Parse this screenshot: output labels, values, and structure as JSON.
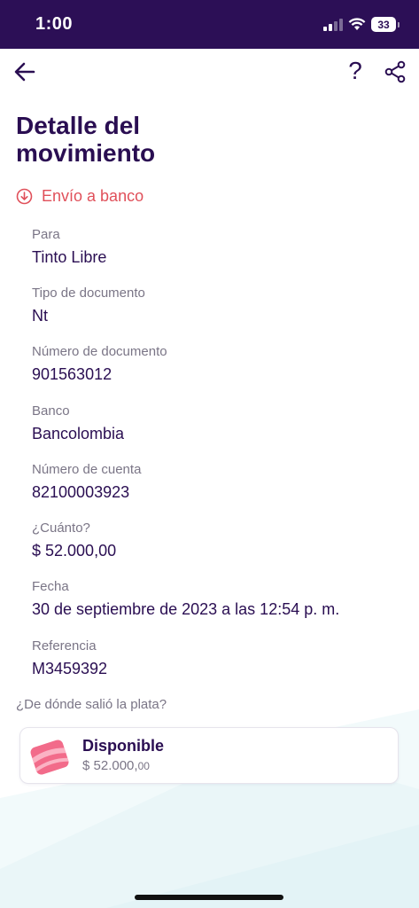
{
  "status_bar": {
    "time": "1:00",
    "battery": "33"
  },
  "header": {
    "help_label": "?"
  },
  "title": "Detalle del movimiento",
  "movement_type": "Envío a banco",
  "fields": [
    {
      "label": "Para",
      "value": "Tinto Libre"
    },
    {
      "label": "Tipo de documento",
      "value": "Nt"
    },
    {
      "label": "Número de documento",
      "value": "901563012"
    },
    {
      "label": "Banco",
      "value": "Bancolombia"
    },
    {
      "label": "Número de cuenta",
      "value": "82100003923"
    },
    {
      "label": "¿Cuánto?",
      "value": "$ 52.000,00"
    },
    {
      "label": "Fecha",
      "value": "30 de septiembre de 2023 a las 12:54 p. m."
    },
    {
      "label": "Referencia",
      "value": "M3459392"
    }
  ],
  "source": {
    "question": "¿De dónde salió la plata?",
    "pocket_name": "Disponible",
    "amount_main": "$ 52.000,",
    "amount_cents": "00"
  },
  "colors": {
    "header_bg": "#2c0f56",
    "primary_text": "#2a0e52",
    "accent_red": "#e0505a",
    "secondary_text": "#7a7586"
  },
  "icons": [
    "back-arrow-icon",
    "help-icon",
    "share-icon",
    "arrow-down-circle-icon",
    "pocket-icon"
  ]
}
